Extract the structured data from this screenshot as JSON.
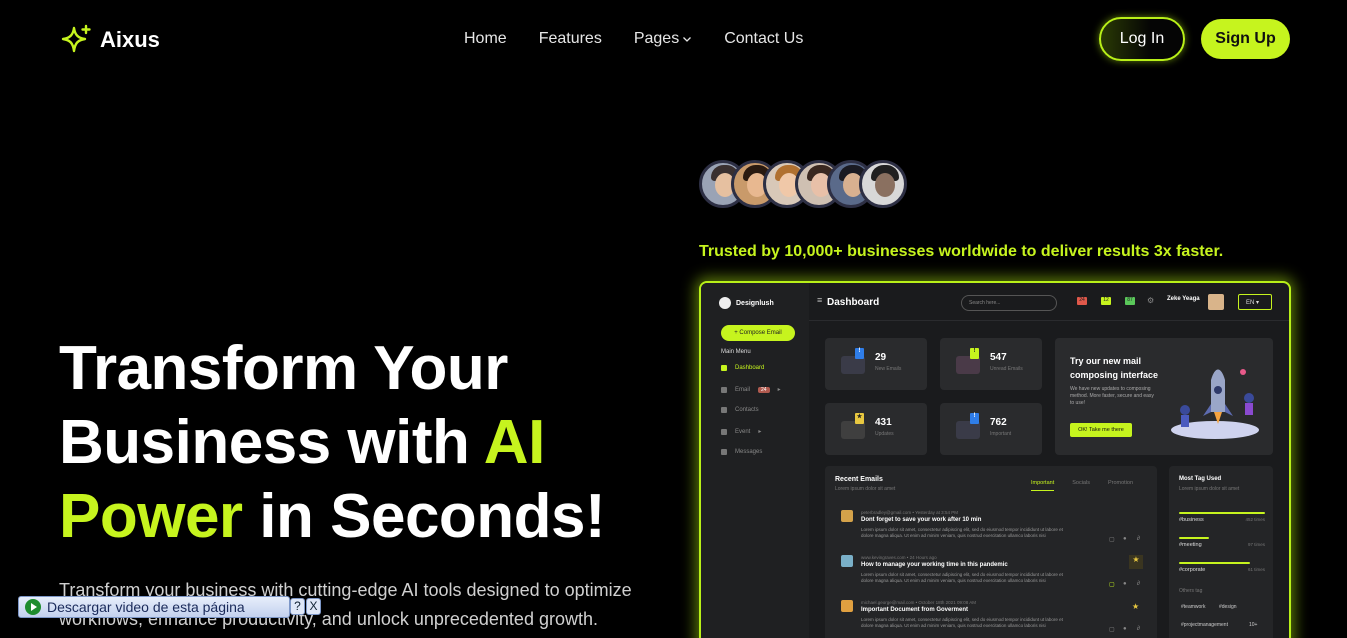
{
  "brand": {
    "name": "Aixus"
  },
  "nav": {
    "items": [
      {
        "label": "Home"
      },
      {
        "label": "Features"
      },
      {
        "label": "Pages"
      },
      {
        "label": "Contact Us"
      }
    ],
    "login_label": "Log In",
    "signup_label": "Sign Up"
  },
  "hero": {
    "title_line1": "Transform Your",
    "title_line2a": "Business with ",
    "title_line2b": "AI",
    "title_line3a": "Power",
    "title_line3b": " in Seconds!",
    "subtitle": "Transform your business with cutting-edge AI tools designed to optimize workflows, enhance productivity, and unlock unprecedented growth.",
    "trusted": "Trusted by 10,000+ businesses worldwide to deliver results 3x faster."
  },
  "dashboard": {
    "brand": "Designlush",
    "compose": "+ Compose Email",
    "main_menu": "Main Menu",
    "menu": [
      {
        "label": "Dashboard"
      },
      {
        "label": "Email",
        "badge": "24"
      },
      {
        "label": "Contacts"
      },
      {
        "label": "Event"
      },
      {
        "label": "Messages"
      }
    ],
    "title": "Dashboard",
    "search_placeholder": "Search here...",
    "notif": [
      "24",
      "12",
      "87"
    ],
    "user": "Zeke Yeaga",
    "lang": "EN",
    "stats": [
      {
        "value": "29",
        "label": "New Emails",
        "flag": "!"
      },
      {
        "value": "547",
        "label": "Unread Emails",
        "flag": "!"
      },
      {
        "value": "431",
        "label": "Updates",
        "flag": "★"
      },
      {
        "value": "762",
        "label": "Important",
        "flag": "!"
      }
    ],
    "promo": {
      "title": "Try our new mail composing interface",
      "text": "We have new updates to composing method. More faster, secure and easy to use!",
      "button": "OK! Take me there"
    },
    "recent": {
      "title": "Recent Emails",
      "subtitle": "Lorem ipsum dolor sit amet",
      "tabs": [
        "Important",
        "Socials",
        "Promotion"
      ],
      "rows": [
        {
          "meta": "peterbradley@gmail.com • Yesterday at 3:54 PM",
          "subject": "Dont forget to save your work after 10 min",
          "body": "Lorem ipsum dolor sit amet, consectetur adipiscing elit, sed do eiusmod tempor incididunt ut labore et dolore magna aliqua. Ut enim ad minim veniam, quis nostrud exercitation ullamco laboris nisi"
        },
        {
          "meta": "www.kevingraves.com • 24 Hours ago",
          "subject": "How to manage your working time in this pandemic",
          "body": "Lorem ipsum dolor sit amet, consectetur adipiscing elit, sed do eiusmod tempor incididunt ut labore et dolore magna aliqua. Ut enim ad minim veniam, quis nostrud exercitation ullamco laboris nisi"
        },
        {
          "meta": "michael.george@mail.com • October 18th 2021 09:08 AM",
          "subject": "Important Document from Goverment",
          "body": "Lorem ipsum dolor sit amet, consectetur adipiscing elit, sed do eiusmod tempor incididunt ut labore et dolore magna aliqua. Ut enim ad minim veniam, quis nostrud exercitation ullamco laboris nisi"
        }
      ]
    },
    "tags": {
      "title": "Most Tag Used",
      "subtitle": "Lorem ipsum dolor sit amet",
      "items": [
        {
          "name": "#business",
          "count": "452 times",
          "fill": 1.0
        },
        {
          "name": "#meeting",
          "count": "97 times",
          "fill": 0.35
        },
        {
          "name": "#corporate",
          "count": "61 times",
          "fill": 0.82
        }
      ],
      "others_label": "Others tag",
      "others": [
        "#teamwork",
        "#design",
        "#projectmanagement",
        "10+"
      ]
    }
  },
  "download_bar": {
    "label": "Descargar video de esta página",
    "help": "?",
    "close": "X"
  },
  "colors": {
    "accent": "#c6f41e",
    "background": "#000000"
  }
}
